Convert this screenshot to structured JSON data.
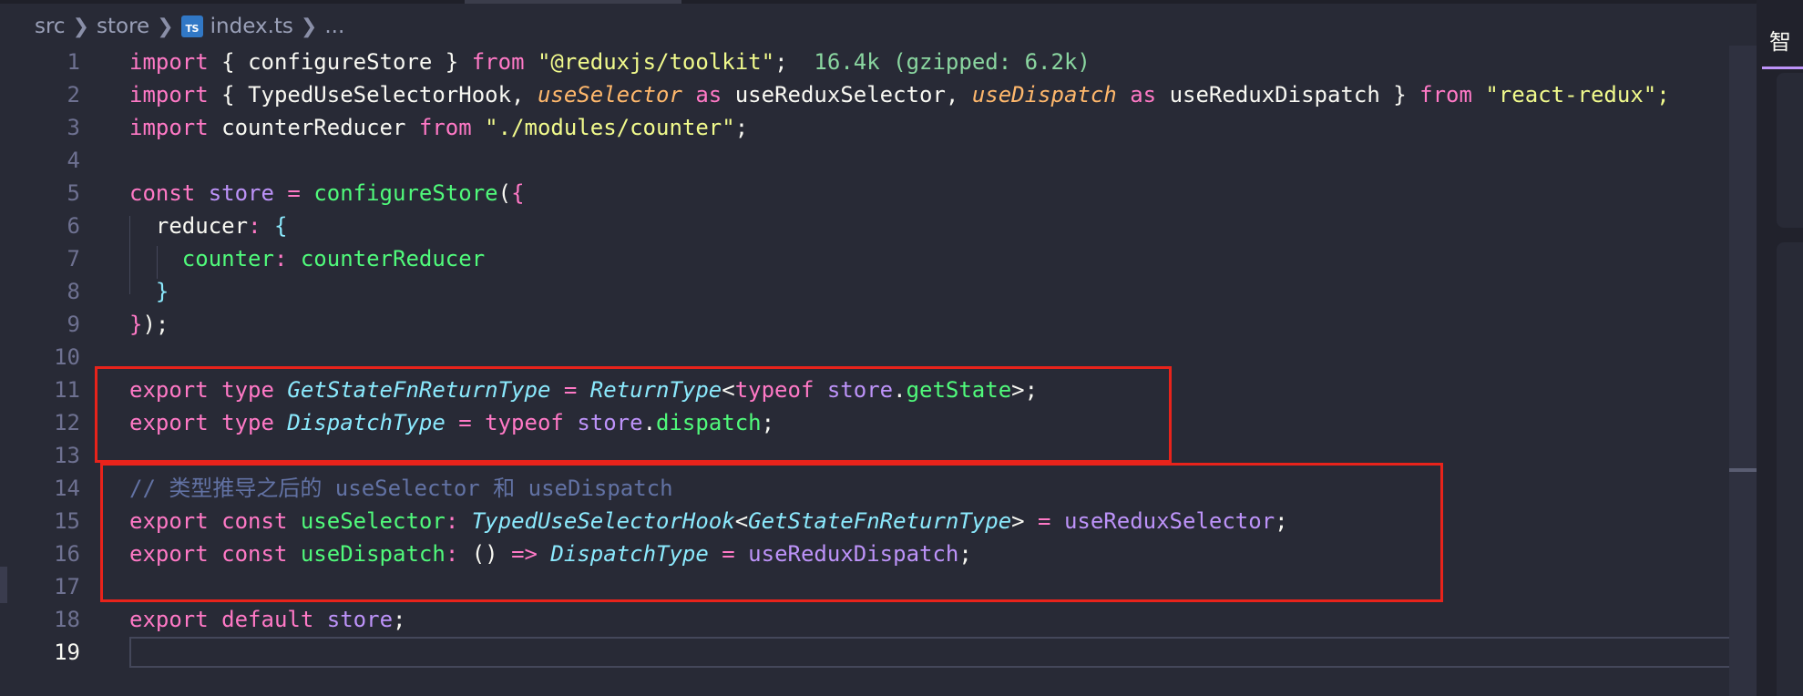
{
  "breadcrumb": {
    "segments": [
      "src",
      "store",
      "index.ts",
      "..."
    ],
    "file_icon": "TS"
  },
  "editor": {
    "line_numbers": [
      "1",
      "2",
      "3",
      "4",
      "5",
      "6",
      "7",
      "8",
      "9",
      "10",
      "11",
      "12",
      "13",
      "14",
      "15",
      "16",
      "17",
      "18",
      "19"
    ],
    "active_line": "19",
    "lines": [
      [
        [
          "kw",
          "import"
        ],
        [
          "pun",
          " { "
        ],
        [
          "id",
          "configureStore"
        ],
        [
          "pun",
          " } "
        ],
        [
          "kw",
          "from"
        ],
        [
          "pun",
          " "
        ],
        [
          "str",
          "\"@reduxjs/toolkit\""
        ],
        [
          "pun",
          ";  "
        ],
        [
          "hint",
          "16.4k (gzipped: 6.2k)"
        ]
      ],
      [
        [
          "kw",
          "import"
        ],
        [
          "pun",
          " { "
        ],
        [
          "id",
          "TypedUseSelectorHook"
        ],
        [
          "pun",
          ", "
        ],
        [
          "ital",
          "useSelector"
        ],
        [
          "pun",
          " "
        ],
        [
          "kw",
          "as"
        ],
        [
          "pun",
          " "
        ],
        [
          "id",
          "useReduxSelector"
        ],
        [
          "pun",
          ", "
        ],
        [
          "ital",
          "useDispatch"
        ],
        [
          "pun",
          " "
        ],
        [
          "kw",
          "as"
        ],
        [
          "pun",
          " "
        ],
        [
          "id",
          "useReduxDispatch"
        ],
        [
          "pun",
          " } "
        ],
        [
          "kw",
          "from"
        ],
        [
          "pun",
          " "
        ],
        [
          "str",
          "\"react-redux\";"
        ]
      ],
      [
        [
          "kw",
          "import"
        ],
        [
          "pun",
          " "
        ],
        [
          "id",
          "counterReducer"
        ],
        [
          "pun",
          " "
        ],
        [
          "kw",
          "from"
        ],
        [
          "pun",
          " "
        ],
        [
          "str",
          "\"./modules/counter\""
        ],
        [
          "pun",
          ";"
        ]
      ],
      [],
      [
        [
          "kw",
          "const"
        ],
        [
          "pun",
          " "
        ],
        [
          "purple",
          "store"
        ],
        [
          "pun",
          " "
        ],
        [
          "kw",
          "="
        ],
        [
          "pun",
          " "
        ],
        [
          "fn",
          "configureStore"
        ],
        [
          "pun",
          "("
        ],
        [
          "br1",
          "{"
        ]
      ],
      [
        [
          "pun",
          "  "
        ],
        [
          "id",
          "reducer"
        ],
        [
          "kw",
          ":"
        ],
        [
          "pun",
          " "
        ],
        [
          "br2",
          "{"
        ]
      ],
      [
        [
          "pun",
          "    "
        ],
        [
          "prop",
          "counter"
        ],
        [
          "kw",
          ":"
        ],
        [
          "pun",
          " "
        ],
        [
          "fn",
          "counterReducer"
        ]
      ],
      [
        [
          "pun",
          "  "
        ],
        [
          "br2",
          "}"
        ]
      ],
      [
        [
          "br1",
          "}"
        ],
        [
          "pun",
          ");"
        ]
      ],
      [],
      [
        [
          "kw",
          "export"
        ],
        [
          "pun",
          " "
        ],
        [
          "kw",
          "type"
        ],
        [
          "pun",
          " "
        ],
        [
          "typ",
          "GetStateFnReturnType"
        ],
        [
          "pun",
          " "
        ],
        [
          "kw",
          "="
        ],
        [
          "pun",
          " "
        ],
        [
          "typ",
          "ReturnType"
        ],
        [
          "pun",
          "<"
        ],
        [
          "kw",
          "typeof"
        ],
        [
          "pun",
          " "
        ],
        [
          "purple",
          "store"
        ],
        [
          "pun",
          "."
        ],
        [
          "fn",
          "getState"
        ],
        [
          "pun",
          ">;"
        ]
      ],
      [
        [
          "kw",
          "export"
        ],
        [
          "pun",
          " "
        ],
        [
          "kw",
          "type"
        ],
        [
          "pun",
          " "
        ],
        [
          "typ",
          "DispatchType"
        ],
        [
          "pun",
          " "
        ],
        [
          "kw",
          "="
        ],
        [
          "pun",
          " "
        ],
        [
          "kw",
          "typeof"
        ],
        [
          "pun",
          " "
        ],
        [
          "purple",
          "store"
        ],
        [
          "pun",
          "."
        ],
        [
          "fn",
          "dispatch"
        ],
        [
          "pun",
          ";"
        ]
      ],
      [],
      [
        [
          "cmt",
          "// 类型推导之后的 useSelector 和 useDispatch"
        ]
      ],
      [
        [
          "kw",
          "export"
        ],
        [
          "pun",
          " "
        ],
        [
          "kw",
          "const"
        ],
        [
          "pun",
          " "
        ],
        [
          "fn",
          "useSelector"
        ],
        [
          "kw",
          ":"
        ],
        [
          "pun",
          " "
        ],
        [
          "typ",
          "TypedUseSelectorHook"
        ],
        [
          "pun",
          "<"
        ],
        [
          "typ",
          "GetStateFnReturnType"
        ],
        [
          "pun",
          "> "
        ],
        [
          "kw",
          "="
        ],
        [
          "pun",
          " "
        ],
        [
          "purple",
          "useReduxSelector"
        ],
        [
          "pun",
          ";"
        ]
      ],
      [
        [
          "kw",
          "export"
        ],
        [
          "pun",
          " "
        ],
        [
          "kw",
          "const"
        ],
        [
          "pun",
          " "
        ],
        [
          "fn",
          "useDispatch"
        ],
        [
          "kw",
          ":"
        ],
        [
          "pun",
          " () "
        ],
        [
          "kw",
          "=>"
        ],
        [
          "pun",
          " "
        ],
        [
          "typ",
          "DispatchType"
        ],
        [
          "pun",
          " "
        ],
        [
          "kw",
          "="
        ],
        [
          "pun",
          " "
        ],
        [
          "purple",
          "useReduxDispatch"
        ],
        [
          "pun",
          ";"
        ]
      ],
      [],
      [
        [
          "kw",
          "export"
        ],
        [
          "pun",
          " "
        ],
        [
          "kw",
          "default"
        ],
        [
          "pun",
          " "
        ],
        [
          "purple",
          "store"
        ],
        [
          "pun",
          ";"
        ]
      ],
      []
    ]
  },
  "side_panel": {
    "tab_label": "智"
  },
  "colors": {
    "background": "#282a36",
    "highlight_box": "#e8231b",
    "keyword": "#ff79c6",
    "string": "#f1fa8c",
    "function": "#50fa7b",
    "type": "#8be9fd",
    "variable": "#bd93f9",
    "comment": "#6272a4"
  }
}
